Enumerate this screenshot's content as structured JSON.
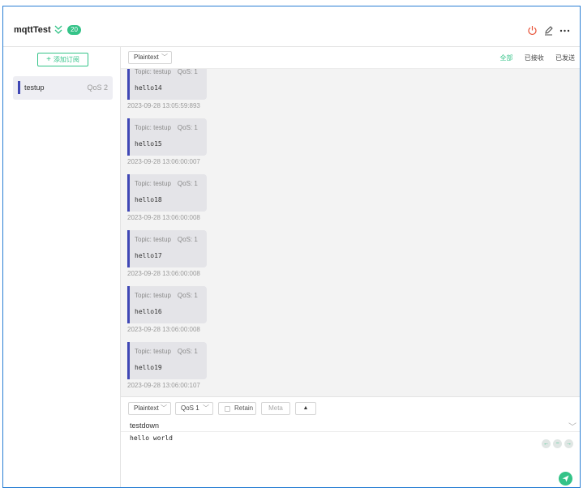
{
  "header": {
    "connection_name": "mqttTest",
    "message_count": "20"
  },
  "sidebar": {
    "add_subscription_label": "添加订阅",
    "subscriptions": [
      {
        "topic": "testup",
        "qos": "QoS 2",
        "color": "#3f47b5"
      }
    ]
  },
  "toolbar": {
    "payload_format": "Plaintext",
    "filters": {
      "all": "全部",
      "received": "已接收",
      "sent": "已发送"
    }
  },
  "messages": [
    {
      "topic": "Topic: testup",
      "qos": "QoS: 1",
      "payload": "hello14",
      "time": "2023-09-28 13:05:59:893"
    },
    {
      "topic": "Topic: testup",
      "qos": "QoS: 1",
      "payload": "hello15",
      "time": "2023-09-28 13:06:00:007"
    },
    {
      "topic": "Topic: testup",
      "qos": "QoS: 1",
      "payload": "hello18",
      "time": "2023-09-28 13:06:00:008"
    },
    {
      "topic": "Topic: testup",
      "qos": "QoS: 1",
      "payload": "hello17",
      "time": "2023-09-28 13:06:00:008"
    },
    {
      "topic": "Topic: testup",
      "qos": "QoS: 1",
      "payload": "hello16",
      "time": "2023-09-28 13:06:00:008"
    },
    {
      "topic": "Topic: testup",
      "qos": "QoS: 1",
      "payload": "hello19",
      "time": "2023-09-28 13:06:00:107"
    }
  ],
  "publish": {
    "payload_format": "Plaintext",
    "qos": "QoS 1",
    "retain_label": "Retain",
    "meta_label": "Meta",
    "topic": "testdown",
    "payload": "hello world"
  },
  "colors": {
    "accent": "#34c388",
    "topic_bar": "#3f47b5",
    "power": "#e8553b"
  }
}
